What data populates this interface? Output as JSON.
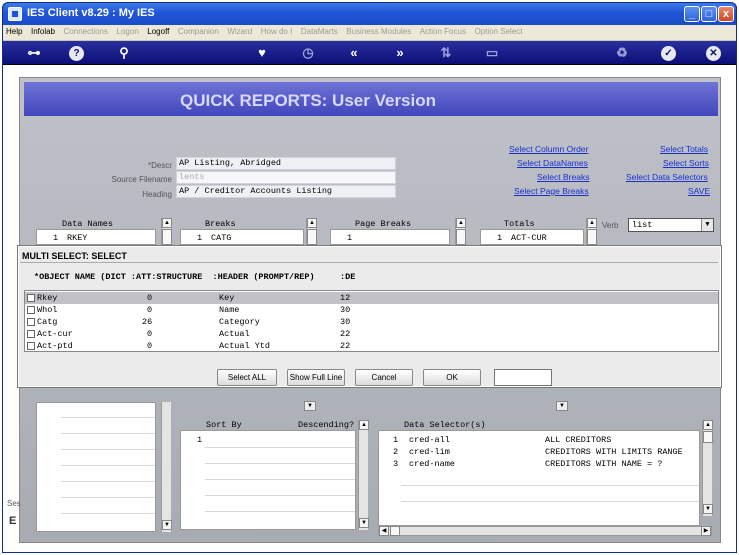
{
  "window": {
    "title": "IES Client v8.29 : My IES",
    "minimize": "_",
    "maximize": "□",
    "close": "x"
  },
  "menu": [
    {
      "label": "Help",
      "enabled": true
    },
    {
      "label": "Infolab",
      "enabled": true
    },
    {
      "label": "Connections",
      "enabled": false
    },
    {
      "label": "Logon",
      "enabled": false
    },
    {
      "label": "Logoff",
      "enabled": true
    },
    {
      "label": "Companion",
      "enabled": false
    },
    {
      "label": "Wizard",
      "enabled": false
    },
    {
      "label": "How do I",
      "enabled": false
    },
    {
      "label": "DataMarts",
      "enabled": false
    },
    {
      "label": "Business Modules",
      "enabled": false
    },
    {
      "label": "Action Focus",
      "enabled": false
    },
    {
      "label": "Option Select",
      "enabled": false
    }
  ],
  "toolbar": {
    "key": "⊶",
    "help": "?",
    "search": "⚲",
    "heart": "♥",
    "clock": "◷",
    "back": "«",
    "forward": "»",
    "sort": "⇅",
    "copy": "▭",
    "recycle": "♻",
    "ok": "✓",
    "close": "✕"
  },
  "page": {
    "title": "QUICK REPORTS: User Version"
  },
  "form": {
    "descr_label": "*Descr",
    "descr_value": "AP Listing, Abridged",
    "source_label": "Source Filename",
    "source_value": "lents",
    "heading_label": "Heading",
    "heading_value": "AP / Creditor Accounts Listing"
  },
  "links": {
    "select_column_order": "Select Column Order",
    "select_datanames": "Select DataNames",
    "select_breaks": "Select Breaks",
    "select_page_breaks": "Select Page Breaks",
    "select_totals": "Select Totals",
    "select_sorts": "Select Sorts",
    "select_data_selectors": "Select Data Selectors",
    "save": "SAVE"
  },
  "columns": {
    "data_names": {
      "header": "Data Names",
      "rows": [
        {
          "num": "1",
          "value": "RKEY"
        }
      ]
    },
    "breaks": {
      "header": "Breaks",
      "rows": [
        {
          "num": "1",
          "value": "CATG"
        }
      ]
    },
    "page_breaks": {
      "header": "Page Breaks",
      "rows": [
        {
          "num": "1",
          "value": ""
        }
      ]
    },
    "totals": {
      "header": "Totals",
      "rows": [
        {
          "num": "1",
          "value": "ACT-CUR"
        }
      ]
    }
  },
  "verb": {
    "label": "Verb",
    "value": "list"
  },
  "multi_select": {
    "title": "MULTI SELECT: SELECT",
    "header": "*OBJECT NAME (DICT :ATT:STRUCTURE  :HEADER (PROMPT/REP)     :DE",
    "rows": [
      {
        "name": "Rkey",
        "att": "0",
        "header": "Key",
        "len": "12",
        "selected": true
      },
      {
        "name": "Whol",
        "att": "0",
        "header": "Name",
        "len": "30",
        "selected": false
      },
      {
        "name": "Catg",
        "att": "26",
        "header": "Category",
        "len": "30",
        "selected": false
      },
      {
        "name": "Act-cur",
        "att": "0",
        "header": "Actual",
        "len": "22",
        "selected": false
      },
      {
        "name": "Act-ptd",
        "att": "0",
        "header": "Actual Ytd",
        "len": "22",
        "selected": false
      }
    ],
    "buttons": {
      "select_all": "Select ALL",
      "show_full_line": "Show Full Line",
      "cancel": "Cancel",
      "ok": "OK"
    }
  },
  "sort": {
    "sort_by_label": "Sort By",
    "descending_label": "Descending?",
    "rows": [
      {
        "num": "1",
        "value": ""
      }
    ]
  },
  "data_selectors": {
    "header": "Data Selector(s)",
    "rows": [
      {
        "num": "1",
        "name": "cred-all",
        "desc": "ALL CREDITORS"
      },
      {
        "num": "2",
        "name": "cred-lim",
        "desc": "CREDITORS WITH LIMITS RANGE"
      },
      {
        "num": "3",
        "name": "cred-name",
        "desc": "CREDITORS WITH NAME = ?"
      }
    ]
  },
  "side_stub": {
    "top": "Ses",
    "bottom": "E"
  }
}
